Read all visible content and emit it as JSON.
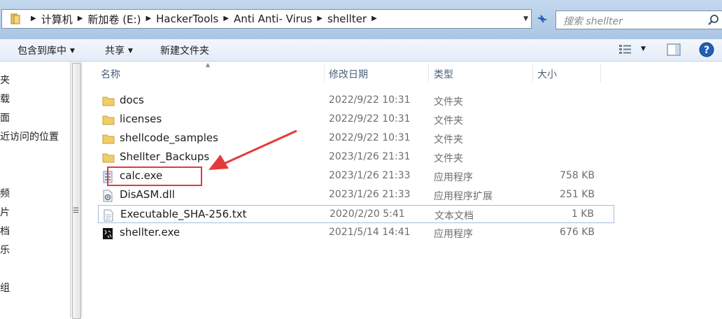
{
  "address_bar": {
    "crumbs": [
      "计算机",
      "新加卷 (E:)",
      "HackerTools",
      "Anti Anti- Virus",
      "shellter"
    ]
  },
  "search": {
    "placeholder": "搜索 shellter"
  },
  "toolbar": {
    "include_library": "包含到库中",
    "share": "共享",
    "new_folder": "新建文件夹"
  },
  "nav": {
    "items": [
      "夹",
      "载",
      "面",
      "近访问的位置",
      "频",
      "片",
      "档",
      "乐",
      "组"
    ]
  },
  "columns": {
    "name": "名称",
    "modified": "修改日期",
    "type": "类型",
    "size": "大小"
  },
  "files": [
    {
      "name": "docs",
      "modified": "2022/9/22 10:31",
      "type": "文件夹",
      "size": "",
      "icon": "folder-icon"
    },
    {
      "name": "licenses",
      "modified": "2022/9/22 10:31",
      "type": "文件夹",
      "size": "",
      "icon": "folder-icon"
    },
    {
      "name": "shellcode_samples",
      "modified": "2022/9/22 10:31",
      "type": "文件夹",
      "size": "",
      "icon": "folder-icon"
    },
    {
      "name": "Shellter_Backups",
      "modified": "2023/1/26 21:31",
      "type": "文件夹",
      "size": "",
      "icon": "folder-icon"
    },
    {
      "name": "calc.exe",
      "modified": "2023/1/26 21:33",
      "type": "应用程序",
      "size": "758 KB",
      "icon": "calc-exe-icon"
    },
    {
      "name": "DisASM.dll",
      "modified": "2023/1/26 21:33",
      "type": "应用程序扩展",
      "size": "251 KB",
      "icon": "dll-icon"
    },
    {
      "name": "Executable_SHA-256.txt",
      "modified": "2020/2/20 5:41",
      "type": "文本文档",
      "size": "1 KB",
      "icon": "text-file-icon"
    },
    {
      "name": "shellter.exe",
      "modified": "2021/5/14 14:41",
      "type": "应用程序",
      "size": "676 KB",
      "icon": "shellter-exe-icon"
    }
  ],
  "colors": {
    "annotation": "#e53a3a",
    "selection_border": "#9fbde3"
  }
}
